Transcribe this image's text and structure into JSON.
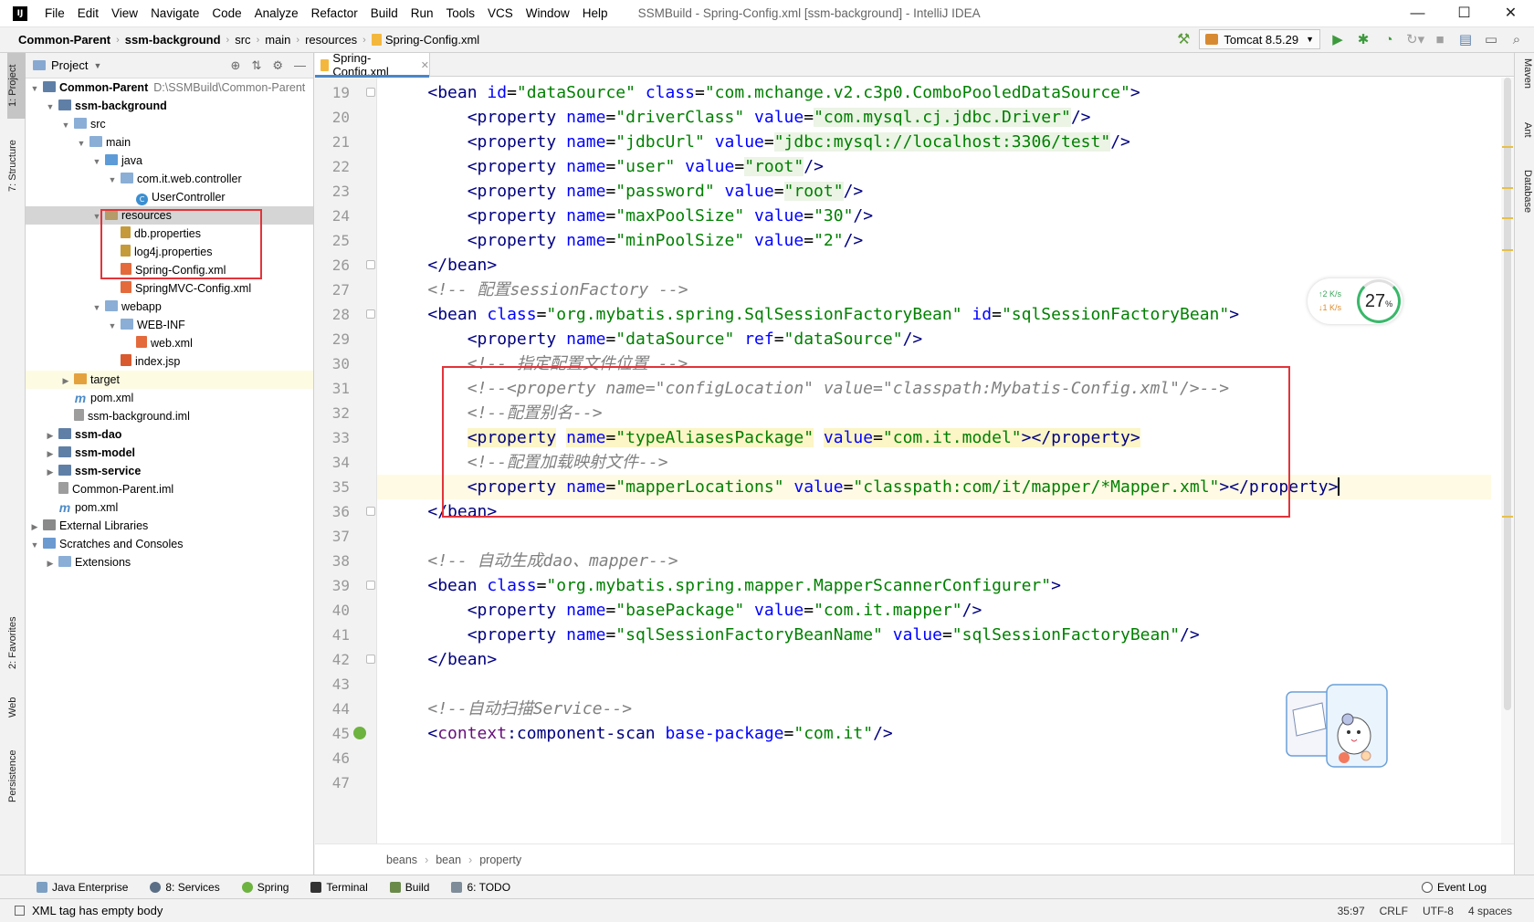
{
  "titlebar": {
    "app_icon": "IJ",
    "menu": [
      "File",
      "Edit",
      "View",
      "Navigate",
      "Code",
      "Analyze",
      "Refactor",
      "Build",
      "Run",
      "Tools",
      "VCS",
      "Window",
      "Help"
    ],
    "title": "SSMBuild - Spring-Config.xml [ssm-background] - IntelliJ IDEA",
    "controls": [
      "—",
      "☐",
      "✕"
    ]
  },
  "navbar": {
    "crumbs": [
      "Common-Parent",
      "ssm-background",
      "src",
      "main",
      "resources",
      "Spring-Config.xml"
    ],
    "run_config": "Tomcat 8.5.29"
  },
  "left_strip": [
    "1: Project",
    "7: Structure",
    "2: Favorites",
    "Web",
    "Persistence"
  ],
  "right_strip": [
    "Maven",
    "Ant",
    "Database"
  ],
  "project": {
    "header": "Project",
    "tree": [
      {
        "label": "Common-Parent",
        "extra": "D:\\SSMBuild\\Common-Parent",
        "indent": 0,
        "toggle": "▼",
        "icon": "module",
        "bold": true
      },
      {
        "label": "ssm-background",
        "indent": 1,
        "toggle": "▼",
        "icon": "module",
        "bold": true
      },
      {
        "label": "src",
        "indent": 2,
        "toggle": "▼",
        "icon": "folder"
      },
      {
        "label": "main",
        "indent": 3,
        "toggle": "▼",
        "icon": "folder"
      },
      {
        "label": "java",
        "indent": 4,
        "toggle": "▼",
        "icon": "folder-src"
      },
      {
        "label": "com.it.web.controller",
        "indent": 5,
        "toggle": "▼",
        "icon": "folder"
      },
      {
        "label": "UserController",
        "indent": 6,
        "toggle": "",
        "icon": "cls"
      },
      {
        "label": "resources",
        "indent": 4,
        "toggle": "▼",
        "icon": "folder-res",
        "selected": true
      },
      {
        "label": "db.properties",
        "indent": 5,
        "toggle": "",
        "icon": "props"
      },
      {
        "label": "log4j.properties",
        "indent": 5,
        "toggle": "",
        "icon": "props"
      },
      {
        "label": "Spring-Config.xml",
        "indent": 5,
        "toggle": "",
        "icon": "xml"
      },
      {
        "label": "SpringMVC-Config.xml",
        "indent": 5,
        "toggle": "",
        "icon": "xml"
      },
      {
        "label": "webapp",
        "indent": 4,
        "toggle": "▼",
        "icon": "folder"
      },
      {
        "label": "WEB-INF",
        "indent": 5,
        "toggle": "▼",
        "icon": "folder"
      },
      {
        "label": "web.xml",
        "indent": 6,
        "toggle": "",
        "icon": "xml"
      },
      {
        "label": "index.jsp",
        "indent": 5,
        "toggle": "",
        "icon": "jsp"
      },
      {
        "label": "target",
        "indent": 2,
        "toggle": "▶",
        "icon": "folder-orange",
        "highlight": true
      },
      {
        "label": "pom.xml",
        "indent": 2,
        "toggle": "",
        "icon": "m"
      },
      {
        "label": "ssm-background.iml",
        "indent": 2,
        "toggle": "",
        "icon": "iml"
      },
      {
        "label": "ssm-dao",
        "indent": 1,
        "toggle": "▶",
        "icon": "module",
        "bold": true
      },
      {
        "label": "ssm-model",
        "indent": 1,
        "toggle": "▶",
        "icon": "module",
        "bold": true
      },
      {
        "label": "ssm-service",
        "indent": 1,
        "toggle": "▶",
        "icon": "module",
        "bold": true
      },
      {
        "label": "Common-Parent.iml",
        "indent": 1,
        "toggle": "",
        "icon": "iml"
      },
      {
        "label": "pom.xml",
        "indent": 1,
        "toggle": "",
        "icon": "m"
      },
      {
        "label": "External Libraries",
        "indent": 0,
        "toggle": "▶",
        "icon": "lib"
      },
      {
        "label": "Scratches and Consoles",
        "indent": 0,
        "toggle": "▼",
        "icon": "scratch"
      },
      {
        "label": "Extensions",
        "indent": 1,
        "toggle": "▶",
        "icon": "folder"
      }
    ]
  },
  "editor": {
    "tab": "Spring-Config.xml",
    "breadcrumb": [
      "beans",
      "bean",
      "property"
    ],
    "lines": [
      {
        "n": "19",
        "fold": true,
        "tokens": [
          [
            "",
            "    "
          ],
          [
            "tag",
            "<bean"
          ],
          [
            "",
            " "
          ],
          [
            "attr",
            "id"
          ],
          [
            "punc",
            "="
          ],
          [
            "val",
            "\"dataSource\""
          ],
          [
            "",
            " "
          ],
          [
            "attr",
            "class"
          ],
          [
            "punc",
            "="
          ],
          [
            "val",
            "\"com.mchange.v2.c3p0.ComboPooledDataSource\""
          ],
          [
            "tag",
            ">"
          ]
        ]
      },
      {
        "n": "20",
        "tokens": [
          [
            "",
            "        "
          ],
          [
            "tag",
            "<property"
          ],
          [
            "",
            " "
          ],
          [
            "attr",
            "name"
          ],
          [
            "punc",
            "="
          ],
          [
            "val",
            "\"driverClass\""
          ],
          [
            "",
            " "
          ],
          [
            "attr",
            "value"
          ],
          [
            "punc",
            "="
          ],
          [
            "val-hl",
            "\"com.mysql.cj.jdbc.Driver\""
          ],
          [
            "tag",
            "/>"
          ]
        ]
      },
      {
        "n": "21",
        "tokens": [
          [
            "",
            "        "
          ],
          [
            "tag",
            "<property"
          ],
          [
            "",
            " "
          ],
          [
            "attr",
            "name"
          ],
          [
            "punc",
            "="
          ],
          [
            "val",
            "\"jdbcUrl\""
          ],
          [
            "",
            " "
          ],
          [
            "attr",
            "value"
          ],
          [
            "punc",
            "="
          ],
          [
            "val-hl",
            "\"jdbc:mysql://localhost:3306/test\""
          ],
          [
            "tag",
            "/>"
          ]
        ]
      },
      {
        "n": "22",
        "tokens": [
          [
            "",
            "        "
          ],
          [
            "tag",
            "<property"
          ],
          [
            "",
            " "
          ],
          [
            "attr",
            "name"
          ],
          [
            "punc",
            "="
          ],
          [
            "val",
            "\"user\""
          ],
          [
            "",
            " "
          ],
          [
            "attr",
            "value"
          ],
          [
            "punc",
            "="
          ],
          [
            "val-hl",
            "\"root\""
          ],
          [
            "tag",
            "/>"
          ]
        ]
      },
      {
        "n": "23",
        "tokens": [
          [
            "",
            "        "
          ],
          [
            "tag",
            "<property"
          ],
          [
            "",
            " "
          ],
          [
            "attr",
            "name"
          ],
          [
            "punc",
            "="
          ],
          [
            "val",
            "\"password\""
          ],
          [
            "",
            " "
          ],
          [
            "attr",
            "value"
          ],
          [
            "punc",
            "="
          ],
          [
            "val-hl",
            "\"root\""
          ],
          [
            "tag",
            "/>"
          ]
        ]
      },
      {
        "n": "24",
        "tokens": [
          [
            "",
            "        "
          ],
          [
            "tag",
            "<property"
          ],
          [
            "",
            " "
          ],
          [
            "attr",
            "name"
          ],
          [
            "punc",
            "="
          ],
          [
            "val",
            "\"maxPoolSize\""
          ],
          [
            "",
            " "
          ],
          [
            "attr",
            "value"
          ],
          [
            "punc",
            "="
          ],
          [
            "val",
            "\"30\""
          ],
          [
            "tag",
            "/>"
          ]
        ]
      },
      {
        "n": "25",
        "tokens": [
          [
            "",
            "        "
          ],
          [
            "tag",
            "<property"
          ],
          [
            "",
            " "
          ],
          [
            "attr",
            "name"
          ],
          [
            "punc",
            "="
          ],
          [
            "val",
            "\"minPoolSize\""
          ],
          [
            "",
            " "
          ],
          [
            "attr",
            "value"
          ],
          [
            "punc",
            "="
          ],
          [
            "val",
            "\"2\""
          ],
          [
            "tag",
            "/>"
          ]
        ]
      },
      {
        "n": "26",
        "fold": true,
        "tokens": [
          [
            "",
            "    "
          ],
          [
            "tag",
            "</bean>"
          ]
        ]
      },
      {
        "n": "27",
        "tokens": [
          [
            "",
            "    "
          ],
          [
            "cmt",
            "<!-- 配置sessionFactory -->"
          ]
        ]
      },
      {
        "n": "28",
        "fold": true,
        "tokens": [
          [
            "",
            "    "
          ],
          [
            "tag",
            "<bean"
          ],
          [
            "",
            " "
          ],
          [
            "attr",
            "class"
          ],
          [
            "punc",
            "="
          ],
          [
            "val",
            "\"org.mybatis.spring.SqlSessionFactoryBean\""
          ],
          [
            "",
            " "
          ],
          [
            "attr",
            "id"
          ],
          [
            "punc",
            "="
          ],
          [
            "val",
            "\"sqlSessionFactoryBean\""
          ],
          [
            "tag",
            ">"
          ]
        ]
      },
      {
        "n": "29",
        "tokens": [
          [
            "",
            "        "
          ],
          [
            "tag",
            "<property"
          ],
          [
            "",
            " "
          ],
          [
            "attr",
            "name"
          ],
          [
            "punc",
            "="
          ],
          [
            "val",
            "\"dataSource\""
          ],
          [
            "",
            " "
          ],
          [
            "attr",
            "ref"
          ],
          [
            "punc",
            "="
          ],
          [
            "val",
            "\"dataSource\""
          ],
          [
            "tag",
            "/>"
          ]
        ]
      },
      {
        "n": "30",
        "tokens": [
          [
            "",
            "        "
          ],
          [
            "cmt",
            "<!-- 指定配置文件位置 -->"
          ]
        ]
      },
      {
        "n": "31",
        "tokens": [
          [
            "",
            "        "
          ],
          [
            "cmt",
            "<!--<property name=\"configLocation\" value=\"classpath:Mybatis-Config.xml\"/>-->"
          ]
        ]
      },
      {
        "n": "32",
        "tokens": [
          [
            "",
            "        "
          ],
          [
            "cmt",
            "<!--配置别名-->"
          ]
        ]
      },
      {
        "n": "33",
        "hl": true,
        "tokens": [
          [
            "",
            "        "
          ],
          [
            "tag",
            "<property"
          ],
          [
            "",
            " "
          ],
          [
            "attr",
            "name"
          ],
          [
            "punc",
            "="
          ],
          [
            "val",
            "\"typeAliasesPackage\""
          ],
          [
            "",
            " "
          ],
          [
            "attr",
            "value"
          ],
          [
            "punc",
            "="
          ],
          [
            "val",
            "\"com.it.model\""
          ],
          [
            "tag",
            "></property>"
          ]
        ]
      },
      {
        "n": "34",
        "tokens": [
          [
            "",
            "        "
          ],
          [
            "cmt",
            "<!--配置加载映射文件-->"
          ]
        ]
      },
      {
        "n": "35",
        "caret": true,
        "tokens": [
          [
            "",
            "        "
          ],
          [
            "tag",
            "<property"
          ],
          [
            "",
            " "
          ],
          [
            "attr",
            "name"
          ],
          [
            "punc",
            "="
          ],
          [
            "val",
            "\"mapperLocations\""
          ],
          [
            "",
            " "
          ],
          [
            "attr",
            "value"
          ],
          [
            "punc",
            "="
          ],
          [
            "val",
            "\"classpath:com/it/mapper/*Mapper.xml\""
          ],
          [
            "tag",
            "></property>"
          ]
        ]
      },
      {
        "n": "36",
        "fold": true,
        "tokens": [
          [
            "",
            "    "
          ],
          [
            "tag",
            "</bean>"
          ]
        ]
      },
      {
        "n": "37",
        "tokens": []
      },
      {
        "n": "38",
        "tokens": [
          [
            "",
            "    "
          ],
          [
            "cmt",
            "<!-- 自动生成dao、mapper-->"
          ]
        ]
      },
      {
        "n": "39",
        "fold": true,
        "tokens": [
          [
            "",
            "    "
          ],
          [
            "tag",
            "<bean"
          ],
          [
            "",
            " "
          ],
          [
            "attr",
            "class"
          ],
          [
            "punc",
            "="
          ],
          [
            "val",
            "\"org.mybatis.spring.mapper.MapperScannerConfigurer\""
          ],
          [
            "tag",
            ">"
          ]
        ]
      },
      {
        "n": "40",
        "tokens": [
          [
            "",
            "        "
          ],
          [
            "tag",
            "<property"
          ],
          [
            "",
            " "
          ],
          [
            "attr",
            "name"
          ],
          [
            "punc",
            "="
          ],
          [
            "val",
            "\"basePackage\""
          ],
          [
            "",
            " "
          ],
          [
            "attr",
            "value"
          ],
          [
            "punc",
            "="
          ],
          [
            "val",
            "\"com.it.mapper\""
          ],
          [
            "tag",
            "/>"
          ]
        ]
      },
      {
        "n": "41",
        "tokens": [
          [
            "",
            "        "
          ],
          [
            "tag",
            "<property"
          ],
          [
            "",
            " "
          ],
          [
            "attr",
            "name"
          ],
          [
            "punc",
            "="
          ],
          [
            "val",
            "\"sqlSessionFactoryBeanName\""
          ],
          [
            "",
            " "
          ],
          [
            "attr",
            "value"
          ],
          [
            "punc",
            "="
          ],
          [
            "val",
            "\"sqlSessionFactoryBean\""
          ],
          [
            "tag",
            "/>"
          ]
        ]
      },
      {
        "n": "42",
        "fold": true,
        "tokens": [
          [
            "",
            "    "
          ],
          [
            "tag",
            "</bean>"
          ]
        ]
      },
      {
        "n": "43",
        "tokens": []
      },
      {
        "n": "44",
        "tokens": [
          [
            "",
            "    "
          ],
          [
            "cmt",
            "<!--自动扫描Service-->"
          ]
        ]
      },
      {
        "n": "45",
        "spring": true,
        "tokens": [
          [
            "",
            "    "
          ],
          [
            "tag",
            "<"
          ],
          [
            "ns",
            "context"
          ],
          [
            "tag",
            ":component-scan"
          ],
          [
            "",
            " "
          ],
          [
            "attr",
            "base-package"
          ],
          [
            "punc",
            "="
          ],
          [
            "val",
            "\"com.it\""
          ],
          [
            "tag",
            "/>"
          ]
        ]
      },
      {
        "n": "46",
        "tokens": []
      },
      {
        "n": "47",
        "tokens": []
      }
    ]
  },
  "net_widget": {
    "up": "↑2  K/s",
    "down": "↓1  K/s",
    "percent": "27",
    "unit": "%"
  },
  "bottom_tabs": [
    "Java Enterprise",
    "8: Services",
    "Spring",
    "Terminal",
    "Build",
    "6: TODO"
  ],
  "event_log": "Event Log",
  "status": {
    "message": "XML tag has empty body",
    "position": "35:97",
    "line_sep": "CRLF",
    "encoding": "UTF-8",
    "indent": "4 spaces"
  }
}
